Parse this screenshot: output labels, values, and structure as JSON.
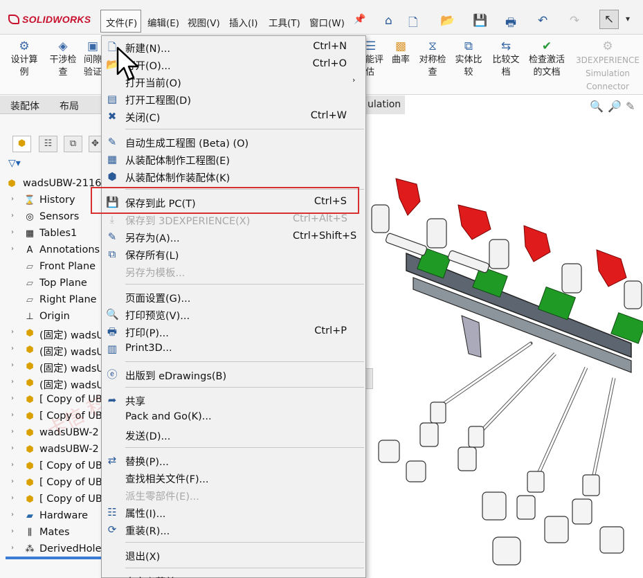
{
  "app": {
    "logo": "SOLIDWORKS"
  },
  "menubar": {
    "items": [
      "文件(F)",
      "编辑(E)",
      "视图(V)",
      "插入(I)",
      "工具(T)",
      "窗口(W)"
    ]
  },
  "ribbon": {
    "left_buttons": [
      "设计算例",
      "干涉检查",
      "间隙验证"
    ],
    "right_buttons": [
      "能评估",
      "曲率",
      "对称检查",
      "实体比较",
      "比较文档",
      "检查激活的文档"
    ],
    "experience": {
      "line1": "3DEXPERIENCE",
      "line2": "Simulation",
      "line3": "Connector"
    }
  },
  "tabs": [
    "装配体",
    "布局"
  ],
  "sim_tab": "ulation",
  "tree": {
    "root": "wadsUBW-2116",
    "items": [
      {
        "label": "History",
        "icon": "history-icon"
      },
      {
        "label": "Sensors",
        "icon": "sensors-icon"
      },
      {
        "label": "Tables1",
        "icon": "table-icon"
      },
      {
        "label": "Annotations",
        "icon": "annotations-icon"
      },
      {
        "label": "Front Plane",
        "icon": "plane-icon"
      },
      {
        "label": "Top Plane",
        "icon": "plane-icon"
      },
      {
        "label": "Right Plane",
        "icon": "plane-icon"
      },
      {
        "label": "Origin",
        "icon": "origin-icon"
      },
      {
        "label": "(固定) wadsU",
        "icon": "assembly-icon"
      },
      {
        "label": "(固定) wadsU",
        "icon": "assembly-icon"
      },
      {
        "label": "(固定) wadsU",
        "icon": "assembly-icon"
      },
      {
        "label": "(固定) wadsU",
        "icon": "assembly-icon"
      },
      {
        "label": "[ Copy of UB",
        "icon": "assembly-icon"
      },
      {
        "label": "[ Copy of UB",
        "icon": "assembly-icon"
      },
      {
        "label": "wadsUBW-2",
        "icon": "assembly-icon"
      },
      {
        "label": "wadsUBW-2",
        "icon": "assembly-icon"
      },
      {
        "label": "[ Copy of UB",
        "icon": "assembly-icon"
      },
      {
        "label": "[ Copy of UB",
        "icon": "assembly-icon"
      },
      {
        "label": "[ Copy of UB",
        "icon": "assembly-icon"
      },
      {
        "label": "Hardware",
        "icon": "folder-icon"
      },
      {
        "label": "Mates",
        "icon": "mates-icon"
      },
      {
        "label": "DerivedHole",
        "icon": "pattern-icon"
      }
    ]
  },
  "file_menu": [
    {
      "label": "新建(N)...",
      "shortcut": "Ctrl+N",
      "icon": "new-icon"
    },
    {
      "label": "打开(O)...",
      "shortcut": "Ctrl+O",
      "icon": "open-icon"
    },
    {
      "label": "打开当前(O)",
      "shortcut": "",
      "icon": ""
    },
    {
      "label": "打开工程图(D)",
      "shortcut": "",
      "icon": "drawing-icon"
    },
    {
      "label": "关闭(C)",
      "shortcut": "Ctrl+W",
      "icon": "close-doc-icon"
    },
    {
      "label": "自动生成工程图 (Beta) (O)",
      "shortcut": "",
      "icon": "auto-drawing-icon"
    },
    {
      "label": "从装配体制作工程图(E)",
      "shortcut": "",
      "icon": "make-drawing-icon"
    },
    {
      "label": "从装配体制作装配体(K)",
      "shortcut": "",
      "icon": "make-assembly-icon"
    },
    {
      "label": "保存到此 PC(T)",
      "shortcut": "Ctrl+S",
      "icon": "save-icon"
    },
    {
      "label": "保存到 3DEXPERIENCE(X)",
      "shortcut": "Ctrl+Alt+S",
      "icon": "save-3dx-icon"
    },
    {
      "label": "另存为(A)...",
      "shortcut": "Ctrl+Shift+S",
      "icon": "save-as-icon"
    },
    {
      "label": "保存所有(L)",
      "shortcut": "",
      "icon": "save-all-icon"
    },
    {
      "label": "另存为模板...",
      "shortcut": "",
      "icon": ""
    },
    {
      "label": "页面设置(G)...",
      "shortcut": "",
      "icon": ""
    },
    {
      "label": "打印预览(V)...",
      "shortcut": "",
      "icon": "print-preview-icon"
    },
    {
      "label": "打印(P)...",
      "shortcut": "Ctrl+P",
      "icon": "print-icon"
    },
    {
      "label": "Print3D...",
      "shortcut": "",
      "icon": "print3d-icon"
    },
    {
      "label": "出版到 eDrawings(B)",
      "shortcut": "",
      "icon": "edrawings-icon"
    },
    {
      "label": "共享",
      "shortcut": "",
      "icon": "share-icon"
    },
    {
      "label": "Pack and Go(K)...",
      "shortcut": "",
      "icon": ""
    },
    {
      "label": "发送(D)...",
      "shortcut": "",
      "icon": ""
    },
    {
      "label": "替换(P)...",
      "shortcut": "",
      "icon": "replace-icon"
    },
    {
      "label": "查找相关文件(F)...",
      "shortcut": "",
      "icon": ""
    },
    {
      "label": "派生零部件(E)...",
      "shortcut": "",
      "icon": ""
    },
    {
      "label": "属性(I)...",
      "shortcut": "",
      "icon": "properties-icon"
    },
    {
      "label": "重装(R)...",
      "shortcut": "",
      "icon": "reload-icon"
    },
    {
      "label": "退出(X)",
      "shortcut": "",
      "icon": ""
    },
    {
      "label": "自定义菜单(M)",
      "shortcut": "",
      "icon": ""
    }
  ],
  "colors": {
    "highlight": "#d92e2e",
    "handle_red": "#e01b1b",
    "block_green": "#1f9a24",
    "logo": "#c8102e"
  }
}
